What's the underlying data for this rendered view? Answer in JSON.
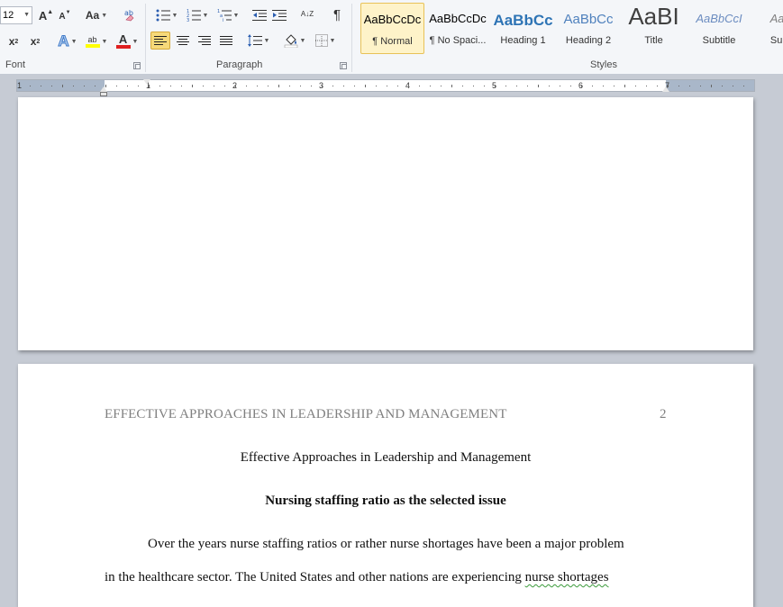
{
  "ribbon": {
    "font_size": "12",
    "groups": {
      "font": "Font",
      "paragraph": "Paragraph",
      "styles": "Styles"
    },
    "font_buttons": {
      "grow": "A",
      "shrink": "A",
      "change_case": "Aa",
      "subscript": "x",
      "subscript_mark": "2",
      "superscript": "x",
      "superscript_mark": "2",
      "text_effects": "A",
      "highlight": "ab",
      "font_color": "A"
    },
    "highlight_color": "#ffff00",
    "font_color_value": "#e02020",
    "paragraph_buttons": {
      "sort": "A↓Z",
      "show_marks": "¶"
    },
    "styles": [
      {
        "preview": "AaBbCcDc",
        "name": "¶ Normal",
        "color": "#000000",
        "size": "13px",
        "italic": false,
        "selected": true
      },
      {
        "preview": "AaBbCcDc",
        "name": "¶ No Spaci...",
        "color": "#000000",
        "size": "13px",
        "italic": false,
        "selected": false
      },
      {
        "preview": "AaBbCc",
        "name": "Heading 1",
        "color": "#2e74b5",
        "size": "17px",
        "italic": false,
        "selected": false,
        "bold": true
      },
      {
        "preview": "AaBbCc",
        "name": "Heading 2",
        "color": "#4f81bd",
        "size": "15px",
        "italic": false,
        "selected": false
      },
      {
        "preview": "AaBI",
        "name": "Title",
        "color": "#404040",
        "size": "26px",
        "italic": false,
        "selected": false
      },
      {
        "preview": "AaBbCcI",
        "name": "Subtitle",
        "color": "#6b8cc0",
        "size": "13px",
        "italic": true,
        "selected": false
      },
      {
        "preview": "AaBb",
        "name": "Subtle",
        "color": "#808080",
        "size": "13px",
        "italic": true,
        "selected": false
      }
    ]
  },
  "ruler": {
    "numbers": [
      "1",
      "1",
      "2",
      "3",
      "4",
      "5",
      "6",
      "7"
    ]
  },
  "document": {
    "header_title": "EFFECTIVE APPROACHES IN LEADERSHIP AND MANAGEMENT",
    "page_number": "2",
    "title": "Effective Approaches in Leadership and Management",
    "heading": "Nursing staffing ratio as the selected  issue",
    "line1": "Over the years nurse staffing ratios or rather nurse shortages have been a major problem",
    "line2_start": "in the healthcare sector. The United States and other nations are experiencing ",
    "line2_flagged": "nurse shortages "
  }
}
